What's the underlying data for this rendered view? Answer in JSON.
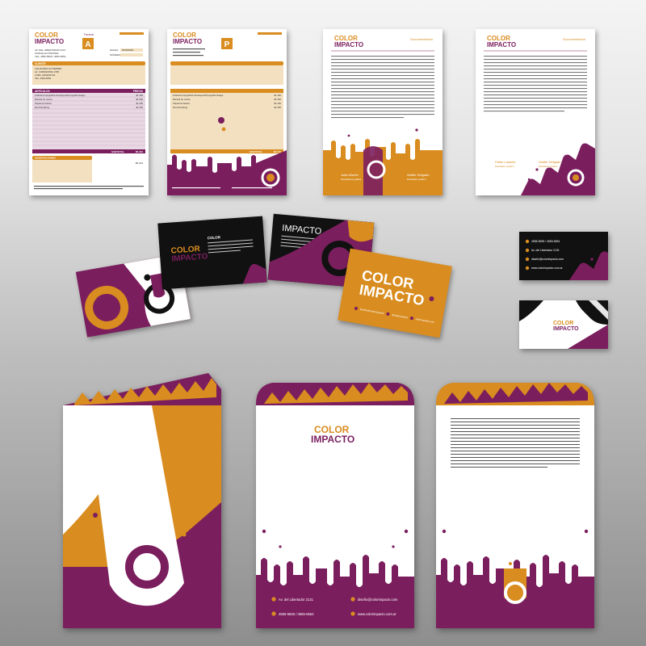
{
  "brand": {
    "line1": "COLOR",
    "line2": "IMPACTO"
  },
  "colors": {
    "purple": "#7b1e5e",
    "orange": "#d98c1f",
    "black": "#111111",
    "white": "#ffffff"
  },
  "invoice_a": {
    "type_label": "Factura",
    "letter": "A",
    "address": [
      "AV. DEL LIBERTADOR 2131",
      "CIUDAD AUTÓNOMA",
      "TEL: 4555-5555 / 4555-5554"
    ],
    "fecha_label": "FECHA:",
    "fecha_value": "00/00/0000",
    "numero_label": "NÚMERO:",
    "cliente_header": "CLIENTE",
    "cliente_lines": [
      "ALEJANDRA GUTIERREZ",
      "AV. CORRIENTES 2356",
      "CABA, ARGENTINA",
      "TEL: 4566-6555"
    ],
    "articulos_header": "ARTÍCULOS",
    "precio_header": "PRECIO",
    "items": [
      {
        "name": "Folletería tipográfica Fierelepara/Tipografía Sadge",
        "price": "$1.400"
      },
      {
        "name": "Manual de marca",
        "price": "$1.500"
      },
      {
        "name": "Papelería básica",
        "price": "$1.200"
      },
      {
        "name": "Merchandising",
        "price": "$1.000"
      }
    ],
    "subtotal_label": "SUBTOTAL",
    "subtotal_value": "$5.100",
    "observaciones_label": "OBSERVACIONES",
    "total_value": "$5.100"
  },
  "invoice_p": {
    "letter": "P",
    "items": [
      {
        "name": "Folletería tipográfica Fierelepara/Tipografía Sadge",
        "price": "$1.400"
      },
      {
        "name": "Manual de marca",
        "price": "$1.500"
      },
      {
        "name": "Papelería básica",
        "price": "$1.200"
      },
      {
        "name": "Merchandising",
        "price": "$1.000"
      }
    ],
    "subtotal_label": "SUBTOTAL",
    "subtotal_value": "$5.100"
  },
  "letterhead_1": {
    "header_right": "Documentación",
    "signer_1_name": "Julia Diseño",
    "signer_1_role": "Diseñadora gráfica",
    "signer_2_name": "Walter Delgado",
    "signer_2_role": "Diseñador gráfico"
  },
  "letterhead_2": {
    "header_right": "Documentación",
    "signer_1_name": "Pablo Lalanne",
    "signer_1_role": "Diseñador gráfico",
    "signer_2_name": "Walter Delgado",
    "signer_2_role": "Diseñador gráfico"
  },
  "card_black": {
    "title": "COLOR",
    "body": "Equipo de diseño dedicado a generar identidades visuales con color e impacto para marcas que buscan destacar."
  },
  "card_black2": {
    "title": "IMPACTO",
    "body": "El impacto visual de una marca es fundamental para su éxito y reconocimiento en el mercado."
  },
  "card_orange": {
    "contact_1": "facebook/colorimpacto",
    "contact_2": "@colorimpacto",
    "contact_3": "colorimpacto.com"
  },
  "small_card": {
    "phone": "4555-5555 / 4555-5554",
    "address": "Av. del Libertador 2131",
    "email": "disaño@colorimpacto.com",
    "web": "www.colorimpacto.com.ar"
  },
  "envelope_1": {
    "address": "Av. del Libertador 2131",
    "phone": "4555-5555 / 4555-5554",
    "email": "diseño@colorimpacto.com",
    "web": "www.colorimpacto.com.ar"
  },
  "lorem": "Lorem ipsum dolor sit amet, consectetuer adipiscing elit, sed diam nonummy nibh euismod tincidunt ut laoreet dolore magna aliquam erat volutpat."
}
